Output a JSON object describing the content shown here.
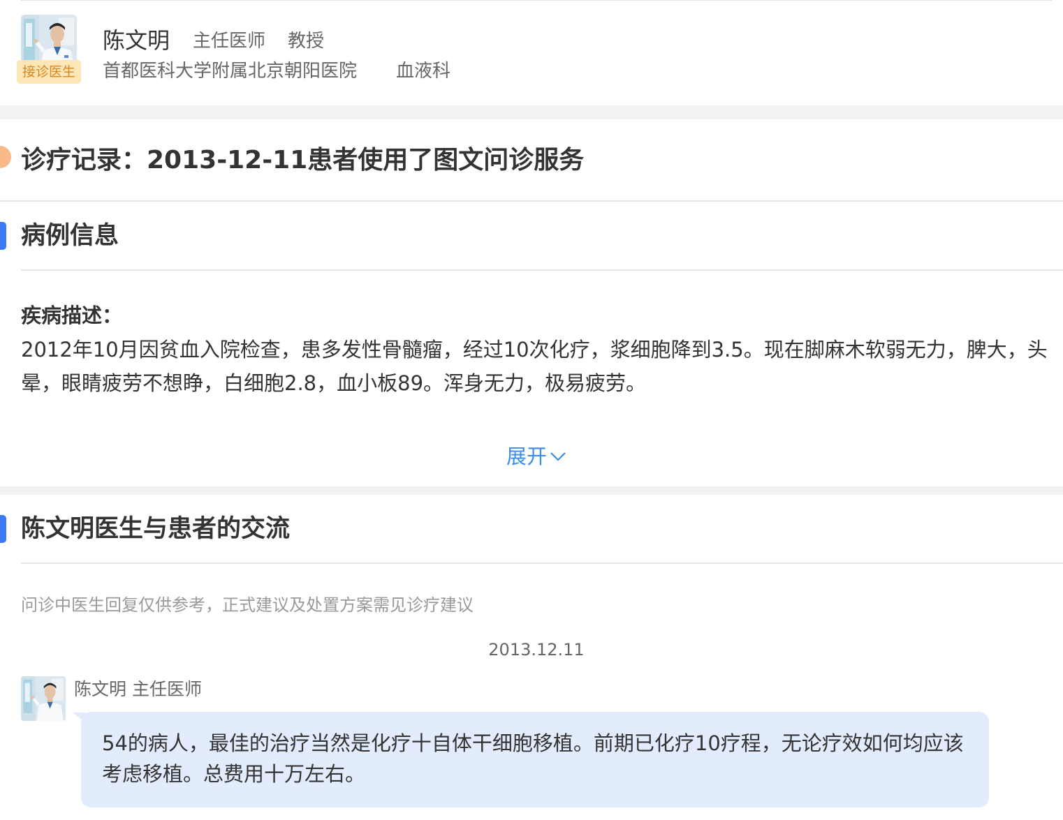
{
  "doctor": {
    "name": "陈文明",
    "title": "主任医师",
    "academic_rank": "教授",
    "hospital": "首都医科大学附属北京朝阳医院",
    "department": "血液科",
    "badge": "接诊医生"
  },
  "record": {
    "title": "诊疗记录：2013-12-11患者使用了图文问诊服务"
  },
  "case_info": {
    "section_title": "病例信息",
    "description_label": "疾病描述：",
    "description_text": "2012年10月因贫血入院检查，患多发性骨髓瘤，经过10次化疗，浆细胞降到3.5。现在脚麻木软弱无力，脾大，头晕，眼睛疲劳不想睁，白细胞2.8，血小板89。浑身无力，极易疲劳。",
    "expand_label": "展开"
  },
  "communication": {
    "section_title": "陈文明医生与患者的交流",
    "disclaimer": "问诊中医生回复仅供参考，正式建议及处置方案需见诊疗建议",
    "date": "2013.12.11",
    "messages": [
      {
        "sender": "陈文明 主任医师",
        "text": "54的病人，最佳的治疗当然是化疗十自体干细胞移植。前期已化疗10疗程，无论疗效如何均应该考虑移植。总费用十万左右。"
      }
    ]
  },
  "colors": {
    "accent_blue": "#3d7bf6",
    "link_blue": "#3b8de8",
    "record_dot": "#fbb98a",
    "badge_bg": "#fde7b7",
    "badge_text": "#e0851c",
    "bubble_bg": "#e2ecfc",
    "band_gray": "#f2f2f2"
  }
}
